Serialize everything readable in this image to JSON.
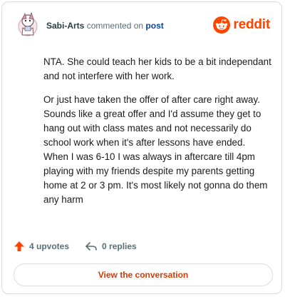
{
  "comment": {
    "username": "Sabi-Arts",
    "action_text": "commented on",
    "post_link": "post",
    "paragraphs": [
      "NTA. She could teach her kids to be a bit independant and not interfere with her work.",
      "Or just have taken the offer of after care right away. Sounds like a great offer and I'd assume they get to hang out with class mates and not necessarily do school work when it's after lessons have ended. When I was 6-10 I was always in aftercare till 4pm playing with my friends despite my parents getting home at 2 or 3 pm. It's most likely not gonna do them any harm"
    ],
    "upvotes": "4 upvotes",
    "replies": "0 replies"
  },
  "brand": {
    "name": "reddit",
    "color": "#ff4500",
    "icon": "reddit-snoo-icon"
  },
  "cta": {
    "label": "View the conversation",
    "color": "#d93a00"
  },
  "icons": {
    "upvote": "upvote-arrow-icon",
    "reply": "reply-arrow-icon",
    "avatar": "user-avatar"
  }
}
